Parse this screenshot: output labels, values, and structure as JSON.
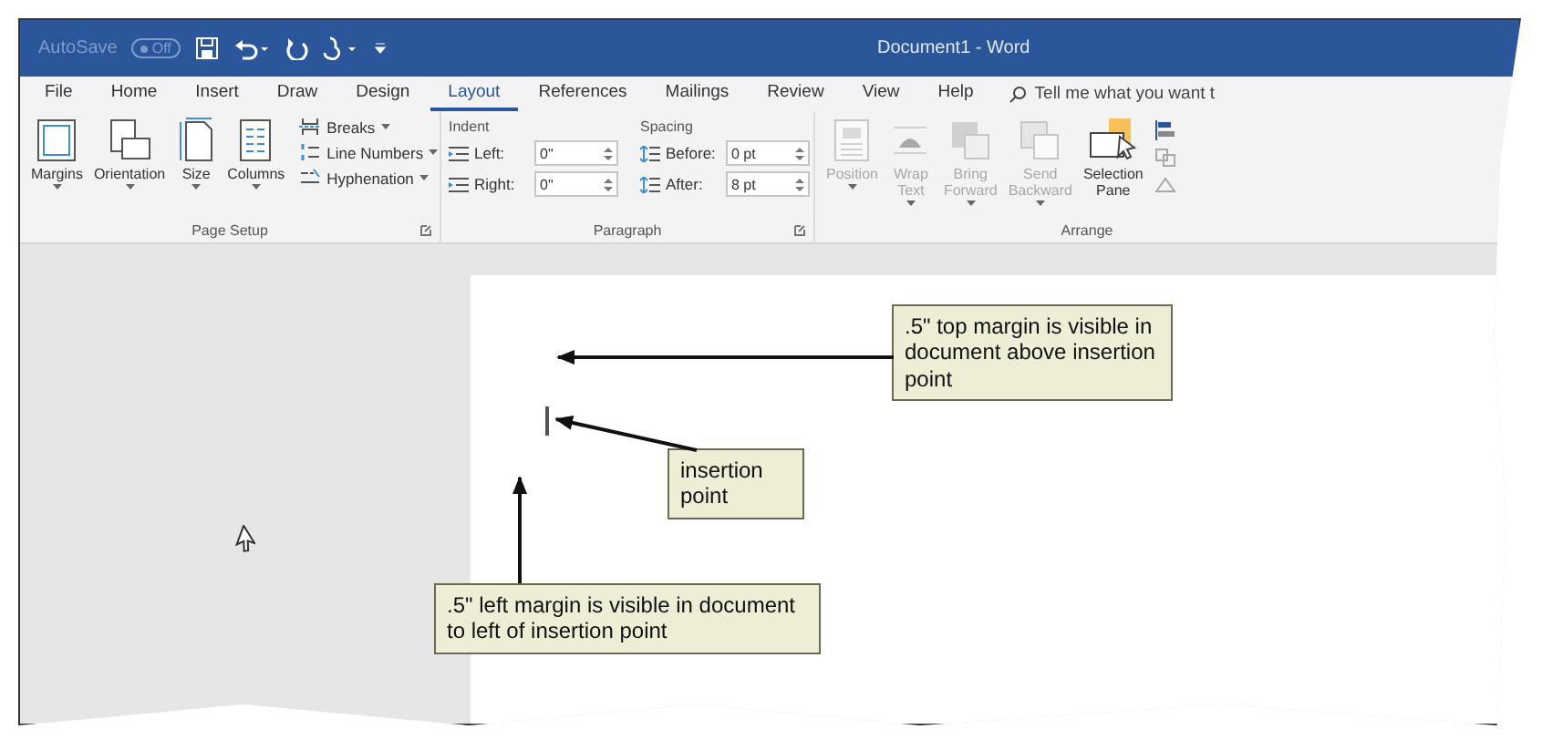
{
  "title_bar": {
    "autosave_label": "AutoSave",
    "autosave_state": "Off",
    "title": "Document1 - Word"
  },
  "tabs": [
    {
      "label": "File",
      "selected": false
    },
    {
      "label": "Home",
      "selected": false
    },
    {
      "label": "Insert",
      "selected": false
    },
    {
      "label": "Draw",
      "selected": false
    },
    {
      "label": "Design",
      "selected": false
    },
    {
      "label": "Layout",
      "selected": true
    },
    {
      "label": "References",
      "selected": false
    },
    {
      "label": "Mailings",
      "selected": false
    },
    {
      "label": "Review",
      "selected": false
    },
    {
      "label": "View",
      "selected": false
    },
    {
      "label": "Help",
      "selected": false
    }
  ],
  "search": {
    "placeholder": "Tell me what you want t"
  },
  "page_setup": {
    "label": "Page Setup",
    "buttons": [
      {
        "label": "Margins",
        "kind": "margins"
      },
      {
        "label": "Orientation",
        "kind": "orientation"
      },
      {
        "label": "Size",
        "kind": "size"
      },
      {
        "label": "Columns",
        "kind": "columns"
      }
    ],
    "small_buttons": [
      {
        "label": "Breaks",
        "kind": "breaks"
      },
      {
        "label": "Line Numbers",
        "kind": "lines"
      },
      {
        "label": "Hyphenation",
        "kind": "hyphen"
      }
    ]
  },
  "paragraph": {
    "label": "Paragraph",
    "indent_label": "Indent",
    "spacing_label": "Spacing",
    "fields": [
      {
        "label": "Left:",
        "value": "0\"",
        "kind": "indent"
      },
      {
        "label": "Before:",
        "value": "0 pt",
        "kind": "spacing"
      },
      {
        "label": "Right:",
        "value": "0\"",
        "kind": "indent"
      },
      {
        "label": "After:",
        "value": "8 pt",
        "kind": "spacing"
      }
    ]
  },
  "arrange": {
    "label": "Arrange",
    "buttons": [
      {
        "label": "Position",
        "kind": "position",
        "disabled": true
      },
      {
        "label": "Wrap Text",
        "kind": "wrap",
        "disabled": true
      },
      {
        "label": "Bring Forward",
        "kind": "bring",
        "disabled": true
      },
      {
        "label": "Send Backward",
        "kind": "send",
        "disabled": true
      },
      {
        "label": "Selection Pane",
        "kind": "selection",
        "disabled": false
      }
    ]
  },
  "callouts": [
    {
      "text": ".5\" top margin is visible in document above insertion point"
    },
    {
      "text": "insertion point"
    },
    {
      "text": ".5\" left margin is visible in document to left of insertion point"
    }
  ]
}
